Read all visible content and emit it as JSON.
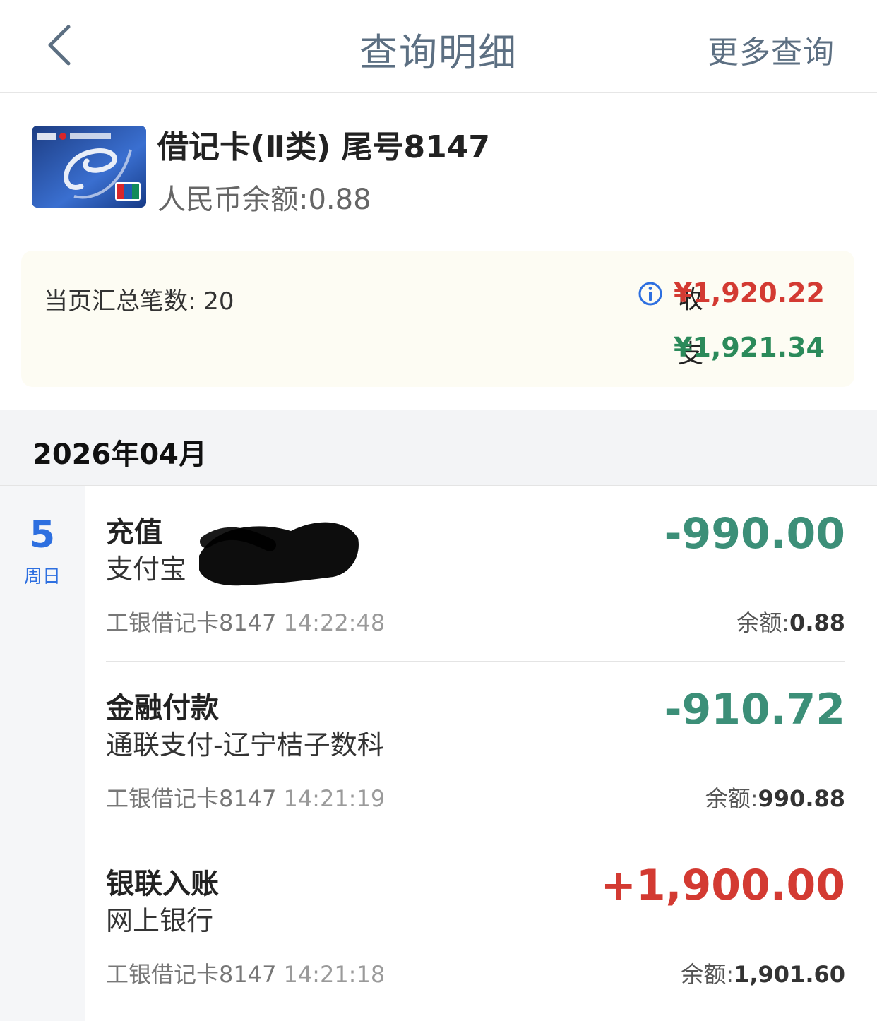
{
  "header": {
    "title": "查询明细",
    "more_label": "更多查询"
  },
  "card": {
    "title": "借记卡(Ⅱ类) 尾号8147",
    "balance_text": "人民币余额:0.88"
  },
  "summary": {
    "count_text": "当页汇总笔数: 20",
    "income_label": "收",
    "income_value": "¥1,920.22",
    "expense_label": "支",
    "expense_value": "¥1,921.34",
    "income_color": "#d33a32",
    "expense_color": "#2b8a5a"
  },
  "month": {
    "label": "2026年04月"
  },
  "day": {
    "num": "5",
    "weekday": "周日"
  },
  "transactions": [
    {
      "type": "充值",
      "desc": "支付宝",
      "card": "工银借记卡8147",
      "time": "14:22:48",
      "amount": "-990.00",
      "balance_label": "余额:",
      "balance_value": "0.88"
    },
    {
      "type": "金融付款",
      "desc": "通联支付-辽宁桔子数科",
      "card": "工银借记卡8147",
      "time": "14:21:19",
      "amount": "-910.72",
      "balance_label": "余额:",
      "balance_value": "990.88"
    },
    {
      "type": "银联入账",
      "desc": "网上银行",
      "card": "工银借记卡8147",
      "time": "14:21:18",
      "amount": "+1,900.00",
      "balance_label": "余额:",
      "balance_value": "1,901.60"
    }
  ],
  "icons": {
    "back": "chevron-left-icon",
    "info": "info-icon"
  }
}
